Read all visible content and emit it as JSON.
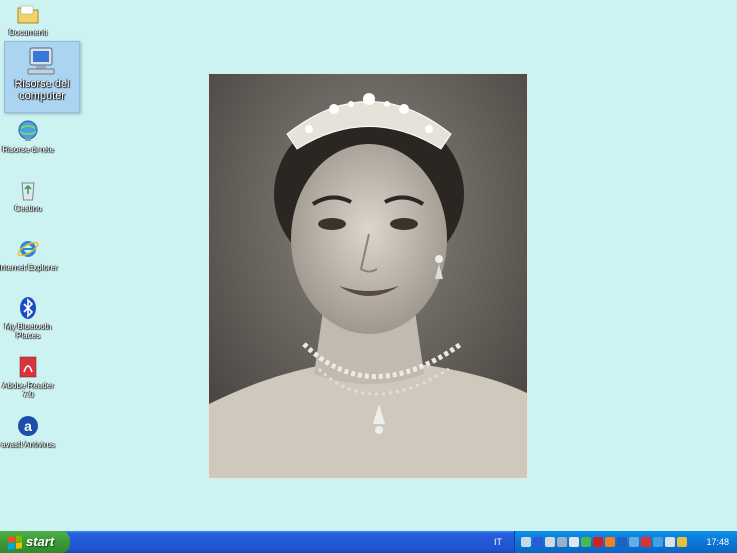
{
  "desktop": {
    "icons": [
      {
        "label": "Documenti"
      },
      {
        "label": "Risorse del computer"
      },
      {
        "label": "Risorse di rete"
      },
      {
        "label": "Cestino"
      },
      {
        "label": "Internet Explorer"
      },
      {
        "label": "My Bluetooth Places"
      },
      {
        "label": "Adobe Reader 7.0"
      },
      {
        "label": "avast! Antivirus"
      }
    ]
  },
  "taskbar": {
    "start_label": "start",
    "language": "IT",
    "clock": "17:48",
    "tray_icons": [
      "network-icon",
      "bluetooth-icon",
      "display-icon",
      "monitor-icon",
      "volume-icon",
      "security-icon",
      "ati-icon",
      "media-icon",
      "update-icon",
      "antivirus-icon",
      "shield-icon",
      "messenger-icon",
      "sync-icon",
      "power-icon"
    ]
  },
  "colors": {
    "desktop_bg": "#cdf2f2",
    "taskbar": "#245edb",
    "start": "#3a9a35",
    "tray": "#0b77d6"
  }
}
